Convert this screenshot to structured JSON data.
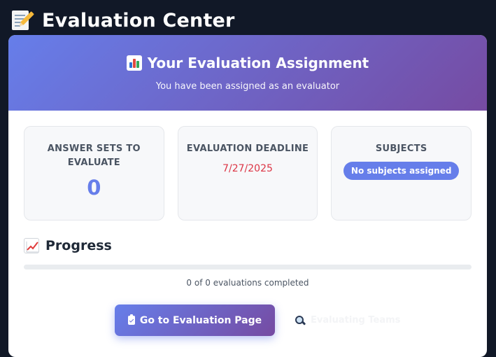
{
  "header": {
    "title": "Evaluation Center",
    "icon": "memo-icon"
  },
  "assignment": {
    "title": "Your Evaluation Assignment",
    "title_icon": "bar-chart-icon",
    "subtitle": "You have been assigned as an evaluator"
  },
  "stats": {
    "answer_sets": {
      "label": "ANSWER SETS TO EVALUATE",
      "value": "0"
    },
    "deadline": {
      "label": "EVALUATION DEADLINE",
      "value": "7/27/2025"
    },
    "subjects": {
      "label": "SUBJECTS",
      "value": "No subjects assigned"
    }
  },
  "progress": {
    "heading": "Progress",
    "heading_icon": "chart-increasing-icon",
    "fraction_complete": 0,
    "summary": "0 of 0 evaluations completed"
  },
  "actions": {
    "primary_label": "Go to Evaluation Page",
    "primary_icon": "clipboard-icon",
    "secondary_label": "Evaluating Teams",
    "secondary_icon": "magnifier-icon"
  },
  "colors": {
    "background": "#111827",
    "accent_start": "#667eea",
    "accent_end": "#764ba2",
    "deadline": "#dc3545"
  }
}
